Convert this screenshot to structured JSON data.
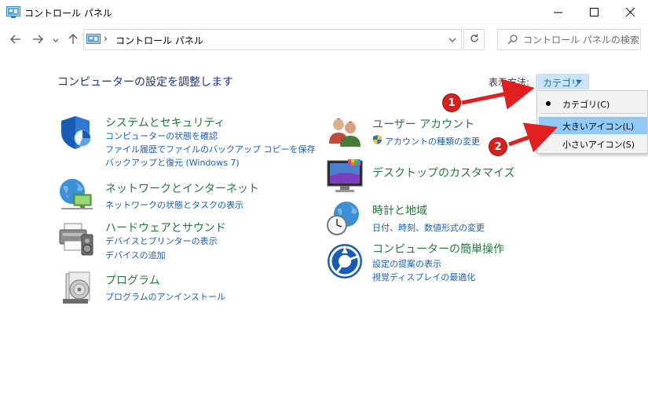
{
  "window": {
    "title": "コントロール パネル",
    "minimize_icon": "minimize-icon",
    "maximize_icon": "maximize-icon",
    "close_icon": "close-icon"
  },
  "address": {
    "separator": "›",
    "path": "コントロール パネル",
    "search_placeholder": "コントロール パネルの検索"
  },
  "main": {
    "title": "コンピューターの設定を調整します",
    "view_label": "表示方法:",
    "view_value": "カテゴリ"
  },
  "categories": [
    {
      "title": "システムとセキュリティ",
      "icon": "shield-icon",
      "links": [
        "コンピューターの状態を確認",
        "ファイル履歴でファイルのバックアップ コピーを保存",
        "バックアップと復元 (Windows 7)"
      ]
    },
    {
      "title": "ネットワークとインターネット",
      "icon": "network-globe-icon",
      "links": [
        "ネットワークの状態とタスクの表示"
      ]
    },
    {
      "title": "ハードウェアとサウンド",
      "icon": "printer-speaker-icon",
      "links": [
        "デバイスとプリンターの表示",
        "デバイスの追加"
      ]
    },
    {
      "title": "プログラム",
      "icon": "program-disc-icon",
      "links": [
        "プログラムのアンインストール"
      ]
    },
    {
      "title": "ユーザー アカウント",
      "icon": "users-icon",
      "links": [
        "アカウントの種類の変更"
      ]
    },
    {
      "title": "デスクトップのカスタマイズ",
      "icon": "monitor-icon",
      "links": []
    },
    {
      "title": "時計と地域",
      "icon": "clock-globe-icon",
      "links": [
        "日付、時刻、数値形式の変更"
      ]
    },
    {
      "title": "コンピューターの簡単操作",
      "icon": "ease-of-access-icon",
      "links": [
        "設定の提案の表示",
        "視覚ディスプレイの最適化"
      ]
    }
  ],
  "menu": {
    "items": [
      "カテゴリ(C)",
      "大きいアイコン(L)",
      "小さいアイコン(S)"
    ],
    "selected": "カテゴリ(C)",
    "highlighted": "大きいアイコン(L)"
  },
  "annotations": {
    "badge1": "1",
    "badge2": "2",
    "color": "#e02020"
  },
  "colors": {
    "category_title": "#217a3c",
    "link": "#1a5fb4",
    "page_title": "#1e3287",
    "menu_highlight": "#91c9f7"
  }
}
